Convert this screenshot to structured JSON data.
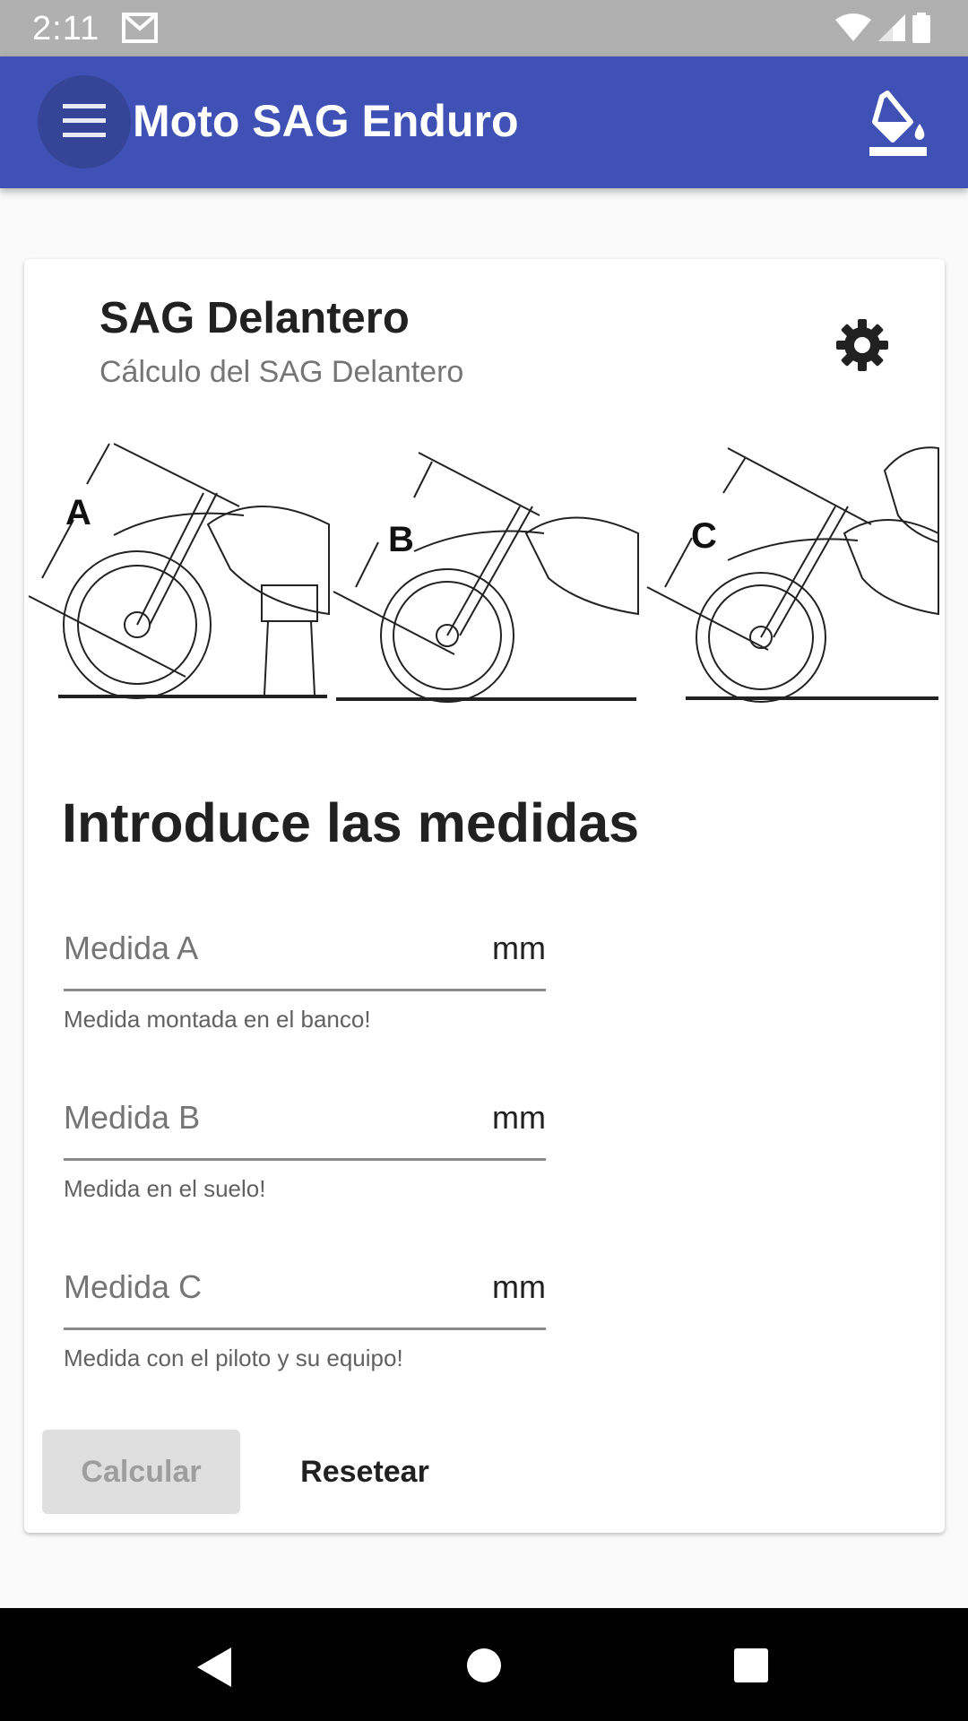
{
  "status_bar": {
    "time": "2:11",
    "icons": [
      "gmail-icon",
      "wifi-icon",
      "signal-icon",
      "battery-icon"
    ]
  },
  "app_bar": {
    "title": "Moto SAG Enduro",
    "menu_icon": "hamburger-menu-icon",
    "action_icon": "paint-bucket-icon",
    "color": "#3f51b5"
  },
  "card": {
    "title": "SAG Delantero",
    "subtitle": "Cálculo del SAG Delantero",
    "settings_icon": "gear-icon",
    "images": [
      {
        "label": "A"
      },
      {
        "label": "B"
      },
      {
        "label": "C"
      }
    ],
    "section_title": "Introduce las medidas",
    "fields": [
      {
        "placeholder": "Medida A",
        "suffix": "mm",
        "helper": "Medida montada en el banco!",
        "value": ""
      },
      {
        "placeholder": "Medida B",
        "suffix": "mm",
        "helper": "Medida en el suelo!",
        "value": ""
      },
      {
        "placeholder": "Medida C",
        "suffix": "mm",
        "helper": "Medida con el piloto y su equipo!",
        "value": ""
      }
    ],
    "buttons": {
      "calculate": "Calcular",
      "reset": "Resetear"
    }
  },
  "nav_bar": {
    "icons": [
      "back-icon",
      "home-icon",
      "recents-icon"
    ]
  }
}
